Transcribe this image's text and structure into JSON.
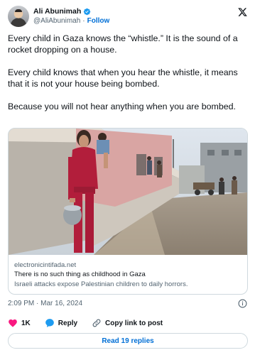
{
  "author": {
    "display_name": "Ali Abunimah",
    "handle": "@AliAbunimah",
    "separator": "·",
    "follow_label": "Follow"
  },
  "tweet": {
    "paragraphs": [
      "Every child in Gaza knows the “whistle.” It is the sound of a rocket dropping on a house.",
      "Every child knows that when you hear the whistle, it means that it is not your house being bombed.",
      "Because you will not hear anything when you are bombed."
    ]
  },
  "card": {
    "domain": "electronicintifada.net",
    "title": "There is no such thing as childhood in Gaza",
    "description": "Israeli attacks expose Palestinian children to daily horrors."
  },
  "timestamp": "2:09 PM · Mar 16, 2024",
  "actions": {
    "like_count": "1K",
    "reply_label": "Reply",
    "copy_label": "Copy link to post"
  },
  "replies_button": "Read 19 replies",
  "colors": {
    "accent": "#006fd6",
    "like": "#f91880",
    "text": "#0f1419",
    "muted": "#536471",
    "border": "#cfd9de"
  },
  "icons": [
    "verified-badge-icon",
    "x-logo-icon",
    "info-icon",
    "heart-icon",
    "reply-bubble-icon",
    "link-icon"
  ]
}
